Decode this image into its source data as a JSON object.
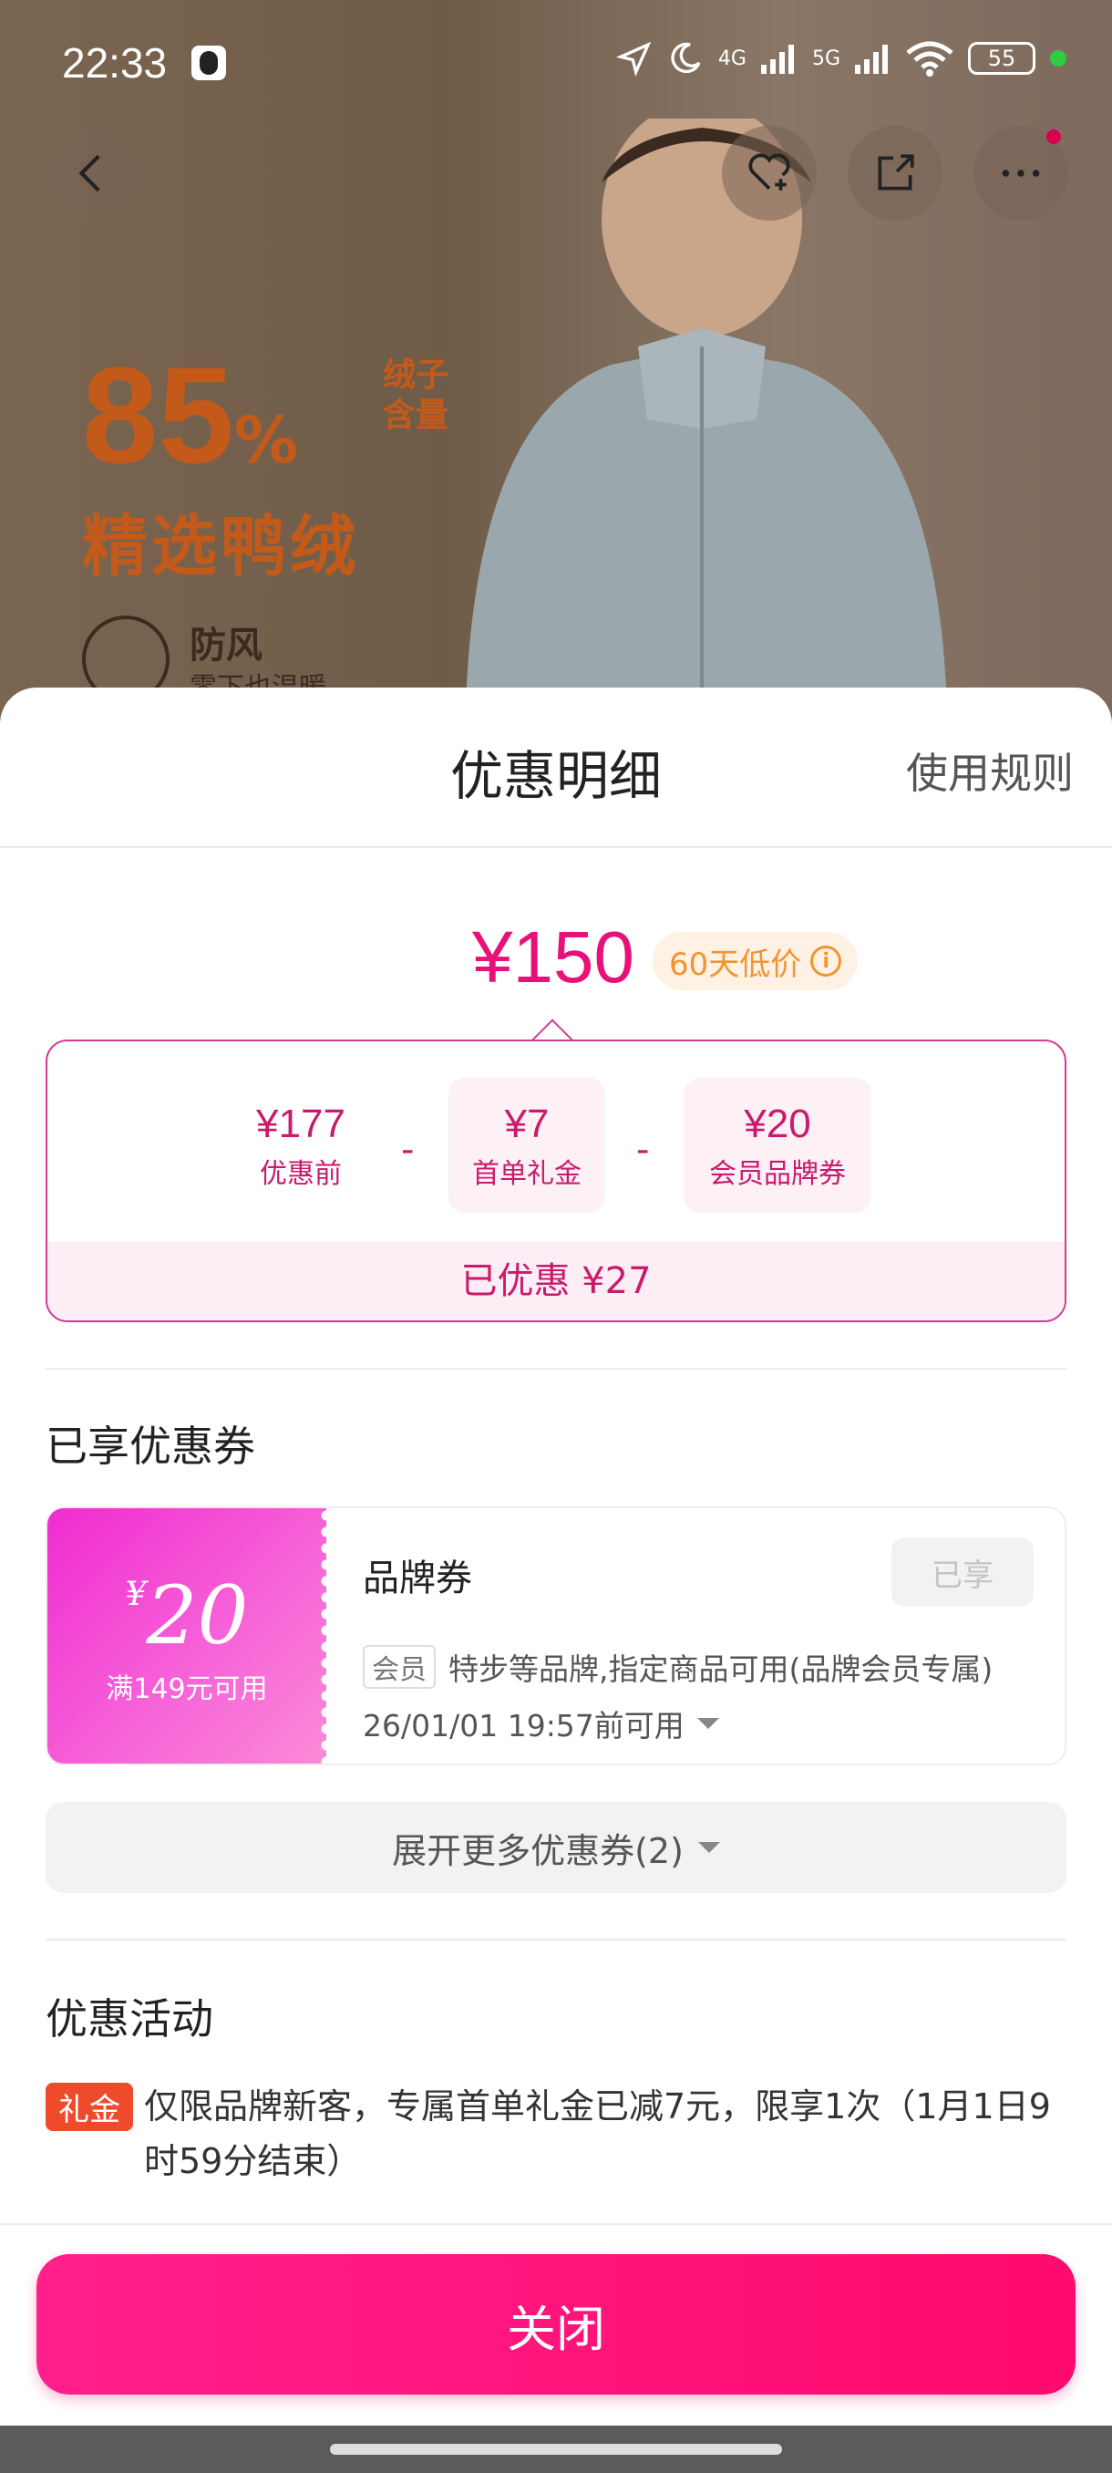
{
  "status_bar": {
    "time": "22:33",
    "network_1": "4G",
    "network_2": "5G",
    "battery": "55"
  },
  "banner": {
    "percent": "85",
    "percent_sign": "%",
    "percent_sub": "绒子含量",
    "headline": "精选鸭绒",
    "feature_title": "防风",
    "feature_sub": "零下也温暖"
  },
  "sheet": {
    "title": "优惠明细",
    "rules_link": "使用规则"
  },
  "price": {
    "final": "¥150",
    "badge": "60天低价",
    "info_glyph": "i"
  },
  "breakdown": {
    "items": [
      {
        "amount": "¥177",
        "label": "优惠前"
      },
      {
        "amount": "¥7",
        "label": "首单礼金"
      },
      {
        "amount": "¥20",
        "label": "会员品牌券"
      }
    ],
    "minus": "-",
    "saved": "已优惠 ¥27"
  },
  "coupons_section": {
    "title": "已享优惠券",
    "coupon": {
      "currency": "¥",
      "amount": "20",
      "condition": "满149元可用",
      "name": "品牌券",
      "status": "已享",
      "member_tag": "会员",
      "description": "特步等品牌,指定商品可用(品牌会员专属)",
      "expiry": "26/01/01 19:57前可用"
    },
    "expand_label": "展开更多优惠券(2)"
  },
  "activity_section": {
    "title": "优惠活动",
    "tag": "礼金",
    "text": "仅限品牌新客，专属首单礼金已减7元，限享1次（1月1日9时59分结束）"
  },
  "close_button": "关闭",
  "colors": {
    "accent": "#e8117a",
    "button": "#ff0a6d",
    "gift_tag": "#ef4b2b",
    "badge_text": "#f29430"
  }
}
